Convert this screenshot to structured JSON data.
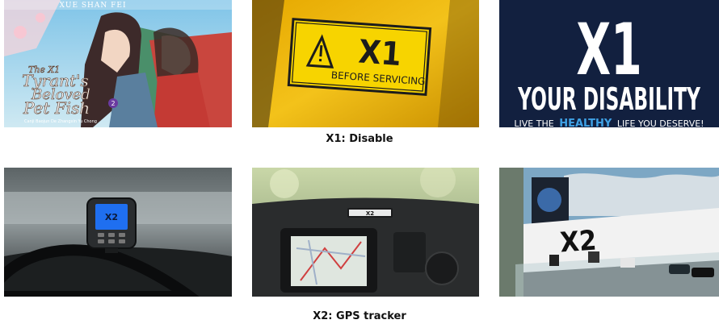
{
  "row1": {
    "caption": "X1: Disable",
    "tiles": [
      {
        "name": "novel-cover",
        "author": "XUE SHAN FEI",
        "title_lines": [
          "The X1",
          "Tyrant's",
          "Beloved",
          "Pet Fish"
        ],
        "volume": "2",
        "subtitle": "Canji Baojun De Zhangxin Yu Chong"
      },
      {
        "name": "warning-sign",
        "big_text": "X1",
        "small_text": "BEFORE SERVICING",
        "icon": "warning-triangle-icon"
      },
      {
        "name": "disability-banner",
        "big_text": "X1",
        "line2": "YOUR DISABILITY",
        "tagline_pre": "LIVE THE",
        "tagline_em": "HEALTHY",
        "tagline_post": "LIFE YOU DESERVE!"
      }
    ]
  },
  "row2": {
    "caption": "X2: GPS tracker",
    "tiles": [
      {
        "name": "gps-device-dashboard",
        "screen_text": "X2"
      },
      {
        "name": "car-navigation-dash",
        "sticker_text": "X2"
      },
      {
        "name": "x2-store-display",
        "sign_text": "X2"
      }
    ]
  },
  "colors": {
    "sign_yellow": "#f2c400",
    "banner_navy": "#12203f",
    "healthy_blue": "#3fa2e6",
    "gps_screen": "#1f6ff0"
  }
}
